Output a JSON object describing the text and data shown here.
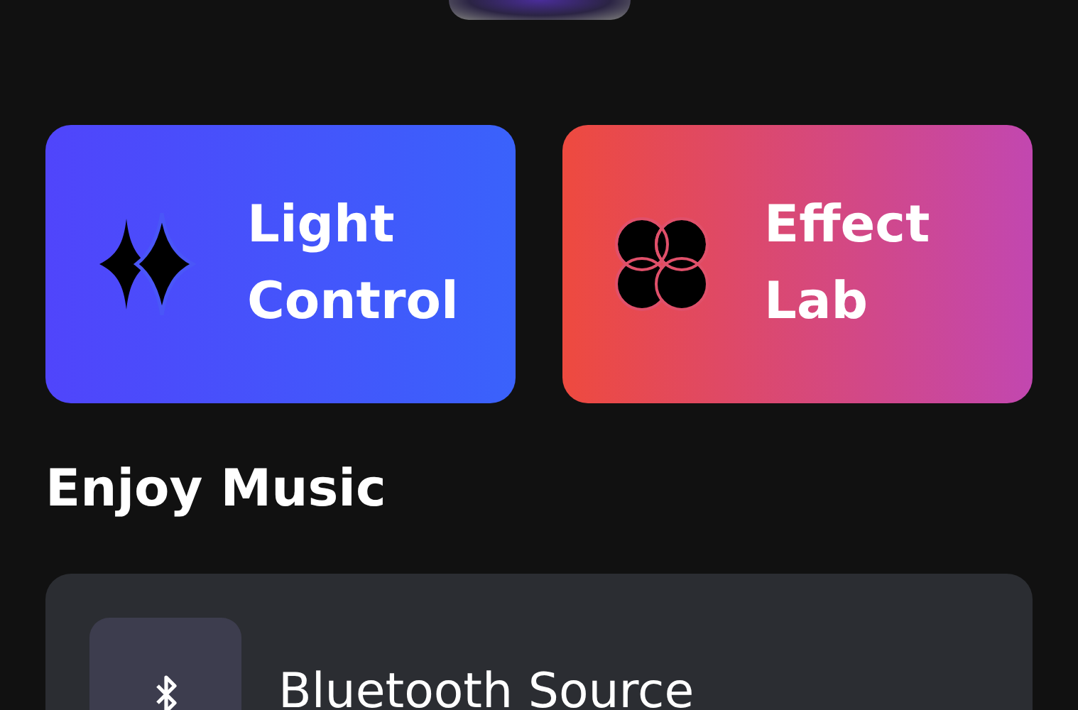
{
  "feature_cards": [
    {
      "kind": "sparkle",
      "label": "Light Control"
    },
    {
      "kind": "petals",
      "label": "Effect Lab"
    }
  ],
  "section_title": "Enjoy Music",
  "music_sources": [
    {
      "kind": "bluetooth",
      "label": "Bluetooth Source"
    }
  ]
}
